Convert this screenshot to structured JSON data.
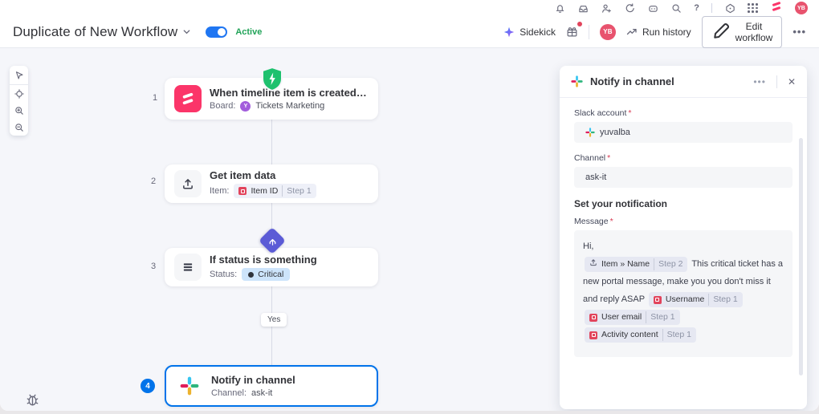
{
  "topbar": {
    "help": "?",
    "avatar_initials": "YB"
  },
  "header": {
    "title": "Duplicate of New Workflow",
    "status_label": "Active",
    "sidekick_label": "Sidekick",
    "avatar_initials": "YB",
    "run_history_label": "Run history",
    "edit_workflow_label": "Edit workflow",
    "menu_dots": "•••"
  },
  "canvas": {
    "branch_label": "Yes",
    "nodes": [
      {
        "index": "1",
        "title": "When timeline item is created in …",
        "field_label": "Board:",
        "field_value": "Tickets Marketing",
        "board_initial": "Y"
      },
      {
        "index": "2",
        "title": "Get item data",
        "field_label": "Item:",
        "token_name": "Item ID",
        "token_step": "Step 1"
      },
      {
        "index": "3",
        "title": "If status is something",
        "field_label": "Status:",
        "status_value": "Critical"
      },
      {
        "index": "4",
        "title": "Notify in channel",
        "field_label": "Channel:",
        "field_value": "ask-it"
      }
    ]
  },
  "panel": {
    "title": "Notify in channel",
    "menu_dots": "•••",
    "close_glyph": "✕",
    "asterisk": "*",
    "slack_account_label": "Slack account",
    "slack_account_value": "yuvalba",
    "channel_label": "Channel",
    "channel_value": "ask-it",
    "section_title": "Set your notification",
    "message_label": "Message",
    "message": {
      "line1": "Hi,",
      "token1_name": "Item » Name",
      "token1_step": "Step 2",
      "body_text": "This critical ticket has a new portal message, make you you don't miss it and reply ASAP",
      "tokens": [
        {
          "name": "Username",
          "step": "Step 1"
        },
        {
          "name": "User email",
          "step": "Step 1"
        },
        {
          "name": "Activity content",
          "step": "Step 1"
        }
      ]
    }
  },
  "colors": {
    "accent_blue": "#0073ea",
    "toggle_blue": "#1f76f2",
    "active_green": "#21a358",
    "trigger_green": "#1ec16e",
    "branch_purple": "#5b5bd6",
    "monday_red": "#fb3569",
    "required_red": "#d83a52",
    "canvas_bg": "#f5f6fa"
  }
}
